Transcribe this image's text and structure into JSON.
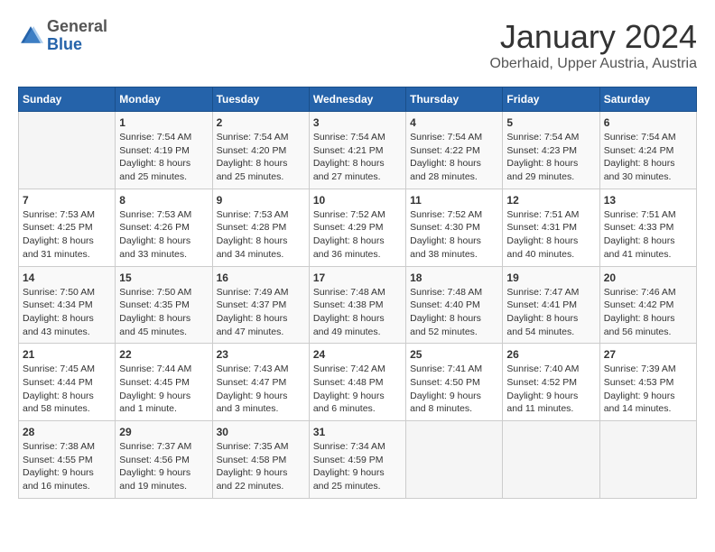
{
  "header": {
    "logo": {
      "general": "General",
      "blue": "Blue"
    },
    "title": "January 2024",
    "location": "Oberhaid, Upper Austria, Austria"
  },
  "days_of_week": [
    "Sunday",
    "Monday",
    "Tuesday",
    "Wednesday",
    "Thursday",
    "Friday",
    "Saturday"
  ],
  "weeks": [
    [
      {
        "day": "",
        "content": ""
      },
      {
        "day": "1",
        "content": "Sunrise: 7:54 AM\nSunset: 4:19 PM\nDaylight: 8 hours\nand 25 minutes."
      },
      {
        "day": "2",
        "content": "Sunrise: 7:54 AM\nSunset: 4:20 PM\nDaylight: 8 hours\nand 25 minutes."
      },
      {
        "day": "3",
        "content": "Sunrise: 7:54 AM\nSunset: 4:21 PM\nDaylight: 8 hours\nand 27 minutes."
      },
      {
        "day": "4",
        "content": "Sunrise: 7:54 AM\nSunset: 4:22 PM\nDaylight: 8 hours\nand 28 minutes."
      },
      {
        "day": "5",
        "content": "Sunrise: 7:54 AM\nSunset: 4:23 PM\nDaylight: 8 hours\nand 29 minutes."
      },
      {
        "day": "6",
        "content": "Sunrise: 7:54 AM\nSunset: 4:24 PM\nDaylight: 8 hours\nand 30 minutes."
      }
    ],
    [
      {
        "day": "7",
        "content": "Sunrise: 7:53 AM\nSunset: 4:25 PM\nDaylight: 8 hours\nand 31 minutes."
      },
      {
        "day": "8",
        "content": "Sunrise: 7:53 AM\nSunset: 4:26 PM\nDaylight: 8 hours\nand 33 minutes."
      },
      {
        "day": "9",
        "content": "Sunrise: 7:53 AM\nSunset: 4:28 PM\nDaylight: 8 hours\nand 34 minutes."
      },
      {
        "day": "10",
        "content": "Sunrise: 7:52 AM\nSunset: 4:29 PM\nDaylight: 8 hours\nand 36 minutes."
      },
      {
        "day": "11",
        "content": "Sunrise: 7:52 AM\nSunset: 4:30 PM\nDaylight: 8 hours\nand 38 minutes."
      },
      {
        "day": "12",
        "content": "Sunrise: 7:51 AM\nSunset: 4:31 PM\nDaylight: 8 hours\nand 40 minutes."
      },
      {
        "day": "13",
        "content": "Sunrise: 7:51 AM\nSunset: 4:33 PM\nDaylight: 8 hours\nand 41 minutes."
      }
    ],
    [
      {
        "day": "14",
        "content": "Sunrise: 7:50 AM\nSunset: 4:34 PM\nDaylight: 8 hours\nand 43 minutes."
      },
      {
        "day": "15",
        "content": "Sunrise: 7:50 AM\nSunset: 4:35 PM\nDaylight: 8 hours\nand 45 minutes."
      },
      {
        "day": "16",
        "content": "Sunrise: 7:49 AM\nSunset: 4:37 PM\nDaylight: 8 hours\nand 47 minutes."
      },
      {
        "day": "17",
        "content": "Sunrise: 7:48 AM\nSunset: 4:38 PM\nDaylight: 8 hours\nand 49 minutes."
      },
      {
        "day": "18",
        "content": "Sunrise: 7:48 AM\nSunset: 4:40 PM\nDaylight: 8 hours\nand 52 minutes."
      },
      {
        "day": "19",
        "content": "Sunrise: 7:47 AM\nSunset: 4:41 PM\nDaylight: 8 hours\nand 54 minutes."
      },
      {
        "day": "20",
        "content": "Sunrise: 7:46 AM\nSunset: 4:42 PM\nDaylight: 8 hours\nand 56 minutes."
      }
    ],
    [
      {
        "day": "21",
        "content": "Sunrise: 7:45 AM\nSunset: 4:44 PM\nDaylight: 8 hours\nand 58 minutes."
      },
      {
        "day": "22",
        "content": "Sunrise: 7:44 AM\nSunset: 4:45 PM\nDaylight: 9 hours\nand 1 minute."
      },
      {
        "day": "23",
        "content": "Sunrise: 7:43 AM\nSunset: 4:47 PM\nDaylight: 9 hours\nand 3 minutes."
      },
      {
        "day": "24",
        "content": "Sunrise: 7:42 AM\nSunset: 4:48 PM\nDaylight: 9 hours\nand 6 minutes."
      },
      {
        "day": "25",
        "content": "Sunrise: 7:41 AM\nSunset: 4:50 PM\nDaylight: 9 hours\nand 8 minutes."
      },
      {
        "day": "26",
        "content": "Sunrise: 7:40 AM\nSunset: 4:52 PM\nDaylight: 9 hours\nand 11 minutes."
      },
      {
        "day": "27",
        "content": "Sunrise: 7:39 AM\nSunset: 4:53 PM\nDaylight: 9 hours\nand 14 minutes."
      }
    ],
    [
      {
        "day": "28",
        "content": "Sunrise: 7:38 AM\nSunset: 4:55 PM\nDaylight: 9 hours\nand 16 minutes."
      },
      {
        "day": "29",
        "content": "Sunrise: 7:37 AM\nSunset: 4:56 PM\nDaylight: 9 hours\nand 19 minutes."
      },
      {
        "day": "30",
        "content": "Sunrise: 7:35 AM\nSunset: 4:58 PM\nDaylight: 9 hours\nand 22 minutes."
      },
      {
        "day": "31",
        "content": "Sunrise: 7:34 AM\nSunset: 4:59 PM\nDaylight: 9 hours\nand 25 minutes."
      },
      {
        "day": "",
        "content": ""
      },
      {
        "day": "",
        "content": ""
      },
      {
        "day": "",
        "content": ""
      }
    ]
  ]
}
